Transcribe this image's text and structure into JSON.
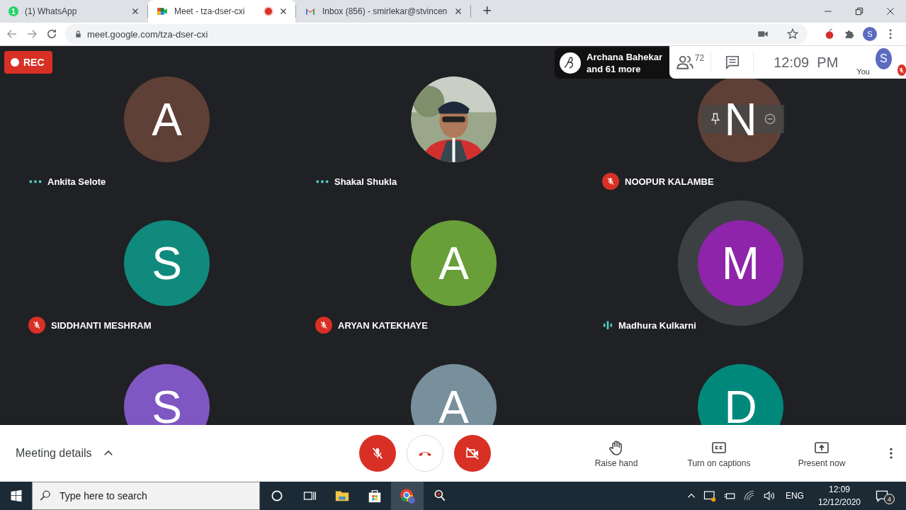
{
  "browser": {
    "tabs": [
      {
        "kind": "whatsapp",
        "title": "(1) WhatsApp",
        "badge": "1",
        "selected": false,
        "recording": false
      },
      {
        "kind": "meet",
        "title": "Meet - tza-dser-cxi",
        "selected": true,
        "recording": true
      },
      {
        "kind": "gmail",
        "title": "Inbox (856) - smirlekar@stvincen",
        "selected": false,
        "recording": false
      }
    ],
    "new_tab": "+",
    "url": "meet.google.com/tza-dser-cxi",
    "profile_initial": "S"
  },
  "meeting": {
    "rec_label": "REC",
    "presenter": {
      "name": "Archana Bahekar",
      "more": "and 61 more"
    },
    "people_count": "72",
    "time": "12:09  PM",
    "self": {
      "initial": "S",
      "label": "You",
      "muted": true
    },
    "participants": [
      {
        "name": "Ankita Selote",
        "initial": "A",
        "color": "#5e4036",
        "kind": "letter",
        "muted": false,
        "speaking": false,
        "hover": false
      },
      {
        "name": "Shakal Shukla",
        "kind": "picture",
        "muted": false,
        "speaking": false,
        "hover": false
      },
      {
        "name": "NOOPUR KALAMBE",
        "initial": "N",
        "color": "#5e4036",
        "kind": "letter",
        "muted": true,
        "speaking": false,
        "hover": true
      },
      {
        "name": "SIDDHANTI MESHRAM",
        "initial": "S",
        "color": "#0f8a7c",
        "kind": "letter",
        "muted": true,
        "speaking": false,
        "hover": false
      },
      {
        "name": "ARYAN KATEKHAYE",
        "initial": "A",
        "color": "#689f38",
        "kind": "letter",
        "muted": true,
        "speaking": false,
        "hover": false
      },
      {
        "name": "Madhura Kulkarni",
        "initial": "M",
        "color": "#8e24aa",
        "kind": "letter",
        "muted": false,
        "speaking": true,
        "hover": false
      },
      {
        "initial": "S",
        "color": "#7e57c2",
        "kind": "letter",
        "hover": false
      },
      {
        "initial": "A",
        "color": "#78909c",
        "kind": "letter",
        "hover": false
      },
      {
        "initial": "D",
        "color": "#00897b",
        "kind": "letter",
        "hover": false
      }
    ]
  },
  "controls": {
    "details": "Meeting details",
    "mic_on": false,
    "camera_on": false,
    "actions": [
      {
        "kind": "hand",
        "label": "Raise hand"
      },
      {
        "kind": "captions",
        "label": "Turn on captions"
      },
      {
        "kind": "present",
        "label": "Present now"
      }
    ]
  },
  "taskbar": {
    "search_placeholder": "Type here to search",
    "language": "ENG",
    "time": "12:09",
    "date": "12/12/2020",
    "notifications": "4"
  }
}
